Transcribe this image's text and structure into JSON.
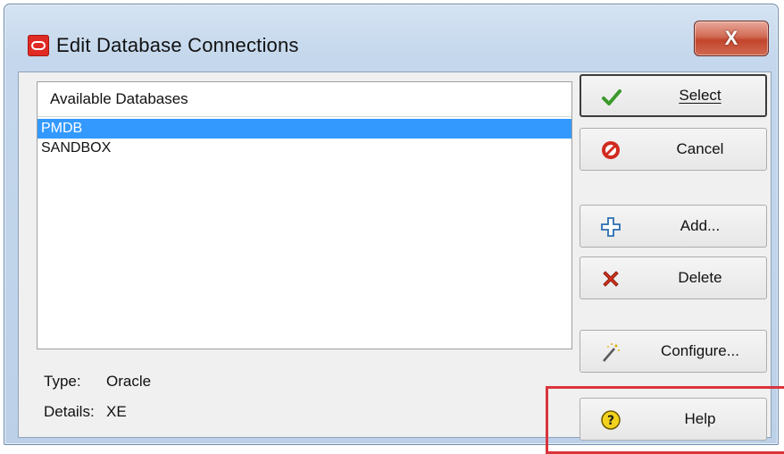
{
  "window": {
    "title": "Edit Database Connections",
    "close_label": "X",
    "app_icon": "oracle-logo-icon"
  },
  "list": {
    "header": "Available Databases",
    "items": [
      {
        "label": "PMDB",
        "selected": true
      },
      {
        "label": "SANDBOX",
        "selected": false
      }
    ]
  },
  "info": {
    "type_label": "Type:",
    "type_value": "Oracle",
    "details_label": "Details:",
    "details_value": "XE"
  },
  "buttons": {
    "select": {
      "label": "Select",
      "icon": "checkmark-icon",
      "color": "#3a9a2a"
    },
    "cancel": {
      "label": "Cancel",
      "icon": "no-entry-icon",
      "color": "#d22a1f"
    },
    "add": {
      "label": "Add...",
      "icon": "plus-icon"
    },
    "delete": {
      "label": "Delete",
      "icon": "delete-x-icon",
      "color": "#d5341c"
    },
    "configure": {
      "label": "Configure...",
      "icon": "magic-wand-icon"
    },
    "help": {
      "label": "Help",
      "icon": "help-icon",
      "color": "#e8c400"
    }
  },
  "highlight_color": "#d9343b"
}
